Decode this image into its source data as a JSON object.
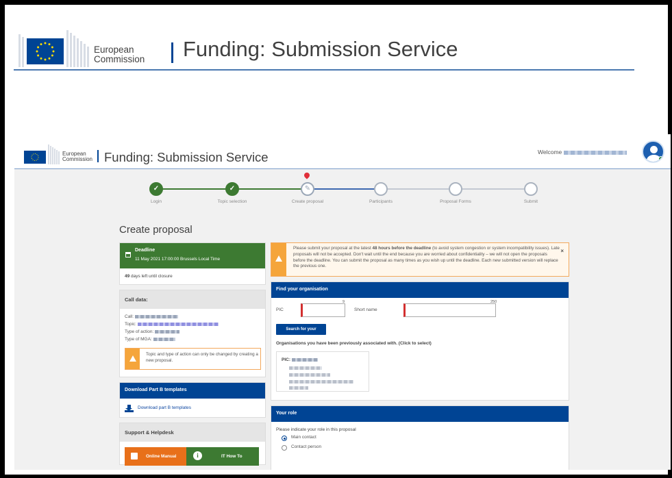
{
  "banner": {
    "ec_line1": "European",
    "ec_line2": "Commission",
    "service_title": "Funding: Submission Service"
  },
  "app": {
    "header": {
      "ec_line1": "European",
      "ec_line2": "Commission",
      "service_title": "Funding: Submission Service",
      "welcome_label": "Welcome"
    },
    "stepper": {
      "steps": [
        {
          "label": "Login",
          "state": "done"
        },
        {
          "label": "Topic selection",
          "state": "done"
        },
        {
          "label": "Create proposal",
          "state": "current"
        },
        {
          "label": "Participants",
          "state": "todo"
        },
        {
          "label": "Proposal Forms",
          "state": "todo"
        },
        {
          "label": "Submit",
          "state": "todo"
        }
      ]
    },
    "page_title": "Create proposal",
    "deadline": {
      "title": "Deadline",
      "date": "11 May 2021 17:00:00 Brussels Local Time",
      "days_count": "49",
      "days_text": " days left until closure"
    },
    "call_data": {
      "title": "Call data:",
      "call_label": "Call:",
      "topic_label": "Topic:",
      "type_of_action_label": "Type of action:",
      "type_of_mga_label": "Type of MGA:",
      "warning": "Topic and type of action can only be changed by creating a new proposal."
    },
    "download": {
      "title": "Download Part B templates",
      "link": "Download part B templates"
    },
    "support": {
      "title": "Support & Helpdesk",
      "online_manual": "Online Manual",
      "it_how_to": "IT How To"
    },
    "notice": {
      "text_a": "Please submit your proposal at the latest ",
      "text_bold": "48 hours before the deadline",
      "text_b": " (to avoid system congestion or system incompatibility issues). Late proposals will not be accepted. Don't wait until the end because you are worried about confidentiality – we will not open the proposals before the deadline. You can submit the proposal as many times as you wish up until the deadline. Each new submitted version will replace the previous one.",
      "close": "×"
    },
    "find_org": {
      "title": "Find your organisation",
      "pic_label": "PIC",
      "pic_max": "9",
      "pic_value": "",
      "short_name_label": "Short name",
      "short_name_max": "250",
      "short_name_value": "",
      "search_button": "Search for your organisation",
      "previous_assoc": "Organisations you have been previously associated with. (Click to select)",
      "card_pic_label": "PIC:"
    },
    "role": {
      "title": "Your role",
      "question": "Please indicate your role in this proposal",
      "options": [
        {
          "label": "Main contact",
          "selected": true
        },
        {
          "label": "Contact person",
          "selected": false
        }
      ]
    }
  },
  "colors": {
    "ec_blue": "#004494",
    "done_green": "#3d7a32",
    "warning_orange": "#f5a53b",
    "manual_orange": "#e8701a",
    "required_red": "#d32f2f",
    "pin_red": "#e0303a"
  }
}
